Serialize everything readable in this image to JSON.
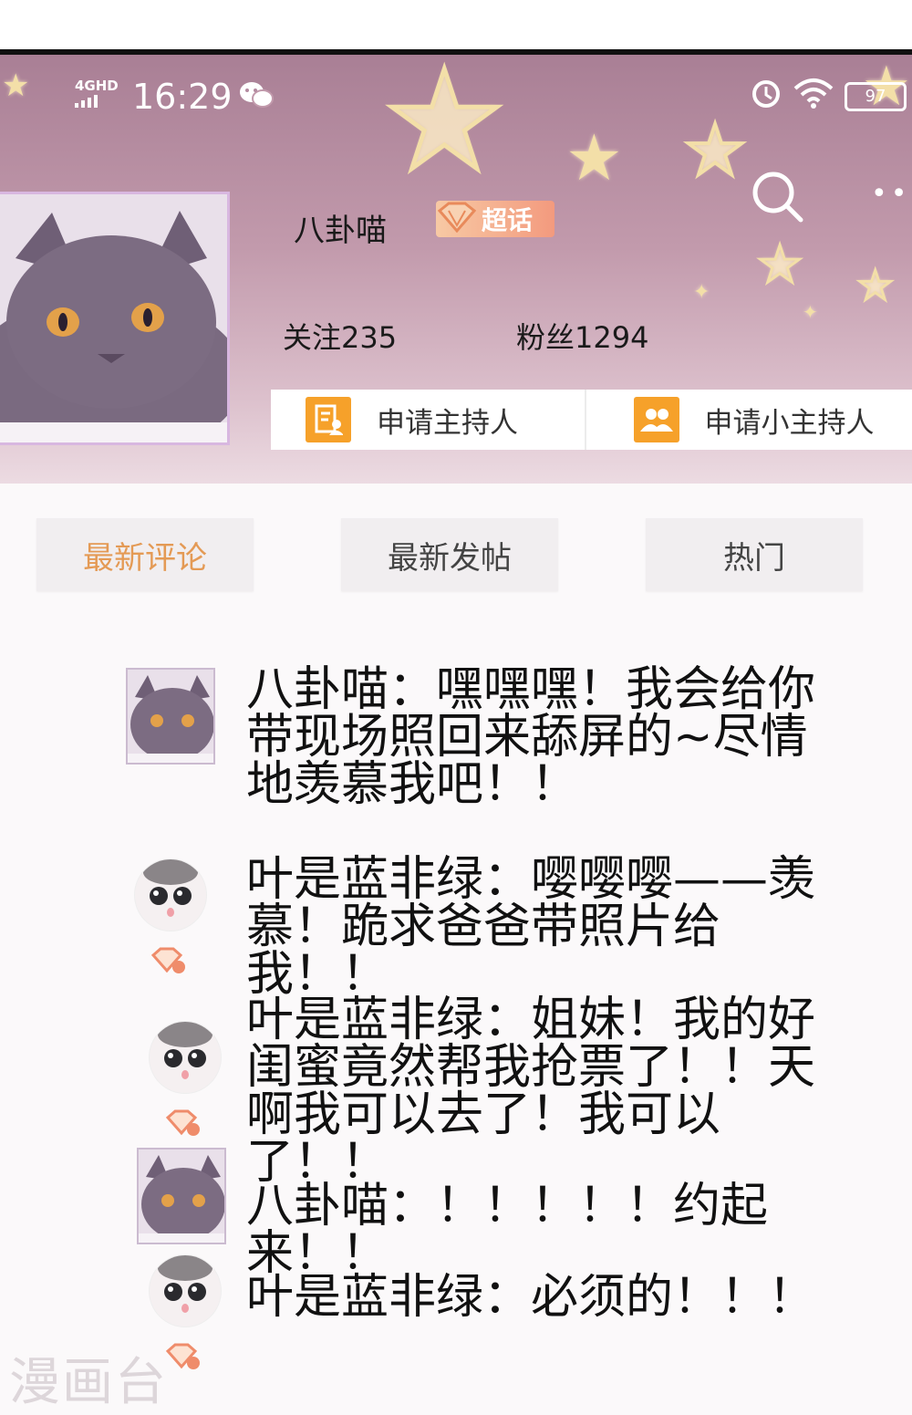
{
  "status_bar": {
    "network": "4GHD",
    "time": "16:29",
    "battery": "97"
  },
  "group": {
    "name": "八卦喵",
    "badge": "超话",
    "follow": "关注235",
    "fans": "粉丝1294"
  },
  "actions": {
    "apply_host": "申请主持人",
    "apply_sub_host": "申请小主持人"
  },
  "tabs": [
    "最新评论",
    "最新发帖",
    "热门"
  ],
  "comments": [
    {
      "text": "八卦喵：嘿嘿嘿！我会给你带现场照回来舔屏的~尽情地羡慕我吧！！"
    },
    {
      "text": "叶是蓝非绿：嘤嘤嘤——羡慕！跪求爸爸带照片给我！！"
    },
    {
      "text": "叶是蓝非绿：姐妹！我的好闺蜜竟然帮我抢票了！！天啊我可以去了！我可以了！！"
    },
    {
      "text": "八卦喵：！！！！！约起来！！"
    },
    {
      "text": "叶是蓝非绿：必须的！！！"
    }
  ],
  "watermark": "漫画台",
  "colors": {
    "header_top": "#a97f95",
    "header_bottom": "#ecdbe2",
    "accent_orange": "#f6a12a",
    "tab_active": "#e49a55",
    "badge": "#f39a7e"
  },
  "icons": [
    "wechat-icon",
    "alarm-icon",
    "wifi-icon",
    "search-icon",
    "more-icon",
    "host-icon",
    "group-icon",
    "diamond-badge-icon",
    "level-badge-icon"
  ]
}
